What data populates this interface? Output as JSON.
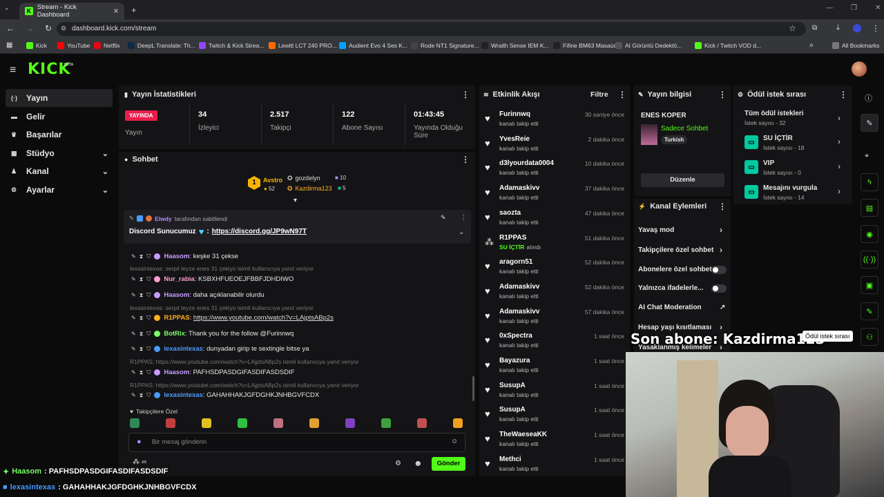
{
  "browser": {
    "tab_title": "Stream - Kick Dashboard",
    "url": "dashboard.kick.com/stream",
    "all_bookmarks": "All Bookmarks",
    "bookmarks": [
      "Kick",
      "YouTube",
      "Netflix",
      "DeepL Translate: Th...",
      "Twitch & Kick Strea...",
      "Lewitt LCT 240 PRO...",
      "Audient Evo 4 Ses K...",
      "Rode NT1 Signature...",
      "Wraith Sense IEM K...",
      "Fifine BM63 Masaüs...",
      "AI Görüntü Dedektö...",
      "Kick / Twitch VOD d..."
    ]
  },
  "header": {
    "logo": "KICK",
    "beta": "BETA"
  },
  "sidebar": {
    "items": [
      {
        "label": "Yayın",
        "icon": "live-icon"
      },
      {
        "label": "Gelir",
        "icon": "wallet-icon"
      },
      {
        "label": "Başarılar",
        "icon": "trophy-icon"
      },
      {
        "label": "Stüdyo",
        "icon": "grid-icon"
      },
      {
        "label": "Kanal",
        "icon": "user-icon"
      },
      {
        "label": "Ayarlar",
        "icon": "gear-icon"
      }
    ]
  },
  "stats": {
    "title": "Yayın İstatistikleri",
    "live_badge": "YAYINDA",
    "live_label": "Yayın",
    "items": [
      {
        "value": "34",
        "label": "İzleyici"
      },
      {
        "value": "2.517",
        "label": "Takipçi"
      },
      {
        "value": "122",
        "label": "Abone Sayısı"
      },
      {
        "value": "01:43:45",
        "label": "Yayında Olduğu Süre"
      }
    ]
  },
  "chat": {
    "title": "Sohbet",
    "top": {
      "first": "Avstro",
      "first_count": "52",
      "second": "gozdelyn",
      "second_count": "10",
      "third": "Kazdirma123",
      "third_count": "5",
      "rank": "1"
    },
    "pinned_by": "Elwdy",
    "pinned_suffix": "tarafından sabitlendi",
    "pinned_text": "Discord Sunucumuz",
    "pinned_link": "https://discord.gg/JP9wN97T",
    "pinned_sep": ":",
    "messages": [
      {
        "user": "Haasom",
        "text": ": keşke 31 çekse",
        "color": "#c99bff"
      },
      {
        "reply": "lexasintexas: serpil teyze enes 31 çekiyo isimli kullanıcıya yanıt veriyor"
      },
      {
        "user": "Nur_rabia",
        "text": ": KSBXHFUEOEJFBBFJDHDIWO",
        "color": "#ff9ecf"
      },
      {
        "user": "Haasom",
        "text": ": daha açıklanabilir olurdu",
        "color": "#c99bff"
      },
      {
        "reply": "lexasintexas: serpil teyze enes 31 çekiyo isimli kullanıcıya yanıt veriyor"
      },
      {
        "user": "R1PPAS",
        "text": ": ",
        "link": "https://www.youtube.com/watch?v=LAjptsABp2s",
        "color": "#ffb020"
      },
      {
        "user": "BotRix",
        "text": ": Thank you for the follow @Furinnwq",
        "color": "#7cff6b"
      },
      {
        "user": "lexasintexas",
        "text": ": dunyadan girip te sextingle bitse ya",
        "color": "#4a9bff"
      },
      {
        "reply": "R1PPAS: https://www.youtube.com/watch?v=LAjptsABp2s isimli kullanıcıya yanıt veriyor"
      },
      {
        "user": "Haasom",
        "text": ": PAFHSDPASDGIFASDIFASDSDIF",
        "color": "#c99bff"
      },
      {
        "reply": "R1PPAS: https://www.youtube.com/watch?v=LAjptsABp2s isimli kullanıcıya yanıt veriyor"
      },
      {
        "user": "lexasintexas",
        "text": ": GAHAHHAKJGFDGHKJNHBGVFCDX",
        "color": "#4a9bff"
      }
    ],
    "followers_only": "Takipçilere Özel",
    "input_placeholder": "Bir mesaj gönderin",
    "send": "Gönder",
    "infinity": "∞"
  },
  "activity": {
    "title": "Etkinlik Akışı",
    "filter": "Filtre",
    "items": [
      {
        "name": "Furinnwq",
        "sub": "kanalı takip etti",
        "time": "30 saniye önce"
      },
      {
        "name": "YvesReie",
        "sub": "kanalı takip etti",
        "time": "2 dakika önce"
      },
      {
        "name": "d3lyourdata0004",
        "sub": "kanalı takip etti",
        "time": "10 dakika önce"
      },
      {
        "name": "Adamaskivv",
        "sub": "kanalı takip etti",
        "time": "37 dakika önce"
      },
      {
        "name": "saozta",
        "sub": "kanalı takip etti",
        "time": "47 dakika önce"
      },
      {
        "name": "R1PPAS",
        "sub": "alındı",
        "highlight": "SU İÇTİR",
        "time": "51 dakika önce"
      },
      {
        "name": "aragorn51",
        "sub": "kanalı takip etti",
        "time": "52 dakika önce"
      },
      {
        "name": "Adamaskivv",
        "sub": "kanalı takip etti",
        "time": "52 dakika önce"
      },
      {
        "name": "Adamaskivv",
        "sub": "kanalı takip etti",
        "time": "57 dakika önce"
      },
      {
        "name": "0xSpectra",
        "sub": "kanalı takip etti",
        "time": "1 saat önce"
      },
      {
        "name": "Bayazura",
        "sub": "kanalı takip etti",
        "time": "1 saat önce"
      },
      {
        "name": "SusupA",
        "sub": "kanalı takip etti",
        "time": "1 saat önce"
      },
      {
        "name": "SusupA",
        "sub": "kanalı takip etti",
        "time": "1 saat önce"
      },
      {
        "name": "TheWaeseaKK",
        "sub": "kanalı takip etti",
        "time": "1 saat önce"
      },
      {
        "name": "Methci",
        "sub": "kanalı takip etti",
        "time": "1 saat önce"
      }
    ]
  },
  "stream_info": {
    "title": "Yayın bilgisi",
    "streamer": "ENES KOPER",
    "category": "Sadece Sohbet",
    "language": "Turkish",
    "edit": "Düzenle"
  },
  "channel_actions": {
    "title": "Kanal Eylemleri",
    "items": [
      "Yavaş mod",
      "Takipçilere özel sohbet",
      "Abonelere özel sohbet",
      "Yalnızca ifadelerle...",
      "AI Chat Moderation",
      "Hesap yaşı kısıtlaması",
      "Yasaklanmış kelimeler"
    ]
  },
  "rewards": {
    "title": "Ödül istek sırası",
    "all": "Tüm ödül istekleri",
    "all_count": "İstek sayısı - 32",
    "items": [
      {
        "name": "SU İÇTİR",
        "count": "İstek sayısı - 18"
      },
      {
        "name": "VIP",
        "count": "İstek sayısı - 0"
      },
      {
        "name": "Mesajını vurgula",
        "count": "İstek sayısı - 14"
      }
    ]
  },
  "overlay": {
    "last_sub": "Son abone: Kazdirma123",
    "tooltip": "Ödül istek sırası",
    "bottom_chat": [
      {
        "user": "Haasom",
        "text": ": PAFHSDPASDGIFASDIFASDSDIF"
      },
      {
        "user": "lexasintexas",
        "text": ": GAHAHHAKJGFDGHKJNHBGVFCDX"
      }
    ]
  },
  "colors": {
    "accent": "#53fc18",
    "live": "#e91e4c",
    "reward": "#00c9a0"
  }
}
